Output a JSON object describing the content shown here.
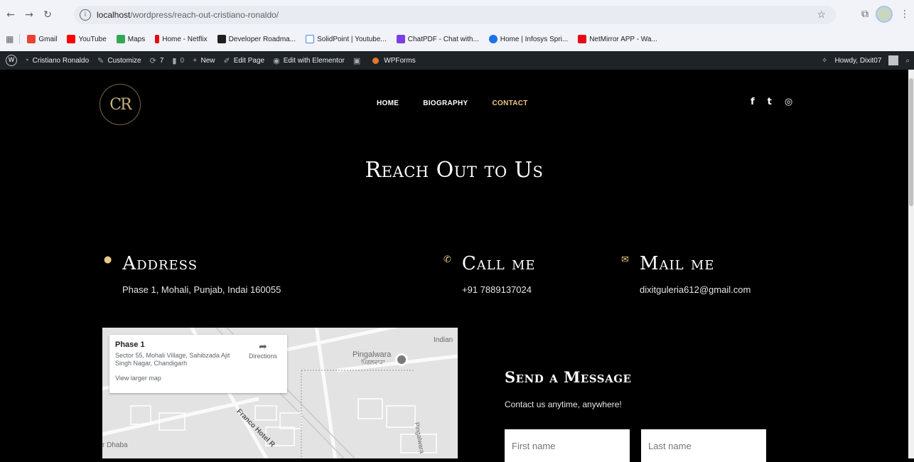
{
  "browser": {
    "url_host": "localhost",
    "url_path": "/wordpress/reach-out-cristiano-ronaldo/",
    "bookmarks": [
      {
        "label": "Gmail",
        "color": "#ea4335"
      },
      {
        "label": "YouTube",
        "color": "#ff0000"
      },
      {
        "label": "Maps",
        "color": "#34a853"
      },
      {
        "label": "Home - Netflix",
        "color": "#e50914"
      },
      {
        "label": "Developer Roadma...",
        "color": "#1f1f1f"
      },
      {
        "label": "SolidPoint | Youtube...",
        "color": "#4285f4"
      },
      {
        "label": "ChatPDF - Chat with...",
        "color": "#7b3fe4"
      },
      {
        "label": "Home | Infosys Spri...",
        "color": "#1a73e8"
      },
      {
        "label": "NetMirror APP - Wa...",
        "color": "#e50914"
      }
    ]
  },
  "admin_bar": {
    "site_name": "Cristiano Ronaldo",
    "customize": "Customize",
    "updates_count": "7",
    "comments_count": "0",
    "new": "New",
    "edit_page": "Edit Page",
    "edit_elementor": "Edit with Elementor",
    "wpforms": "WPForms",
    "howdy": "Howdy, Dixit07"
  },
  "site": {
    "logo_text": "CR",
    "nav": [
      {
        "label": "HOME",
        "active": false
      },
      {
        "label": "BIOGRAPHY",
        "active": false
      },
      {
        "label": "CONTACT",
        "active": true
      }
    ],
    "social_icons": [
      "facebook-icon",
      "twitter-icon",
      "instagram-icon"
    ],
    "hero_title": "Reach Out to Us",
    "address": {
      "title": "Address",
      "text": "Phase 1, Mohali, Punjab, Indai 160055"
    },
    "call": {
      "title": "Call me",
      "text": "+91 7889137024"
    },
    "mail": {
      "title": "Mail me",
      "text": "dixitguleria612@gmail.com"
    },
    "map": {
      "place_title": "Phase 1",
      "place_address": "Sector 55, Mohali Village, Sahibzada Ajit Singh Nagar, Chandigarh",
      "directions": "Directions",
      "view_larger": "View larger map",
      "label_pingalwara": "Pingalwara",
      "label_pingalwara_local": "ਪਿੰਗਲਵਾੜਾ",
      "label_indian": "Indian",
      "label_dhaba": "r Dhaba",
      "label_road": "Franco Hotel R",
      "label_pingalwara_road": "Pingalwara"
    },
    "form": {
      "title": "Send a Message",
      "subtitle": "Contact us anytime, anywhere!",
      "first_name_placeholder": "First name",
      "last_name_placeholder": "Last name"
    },
    "accent_color": "#e8c883"
  }
}
